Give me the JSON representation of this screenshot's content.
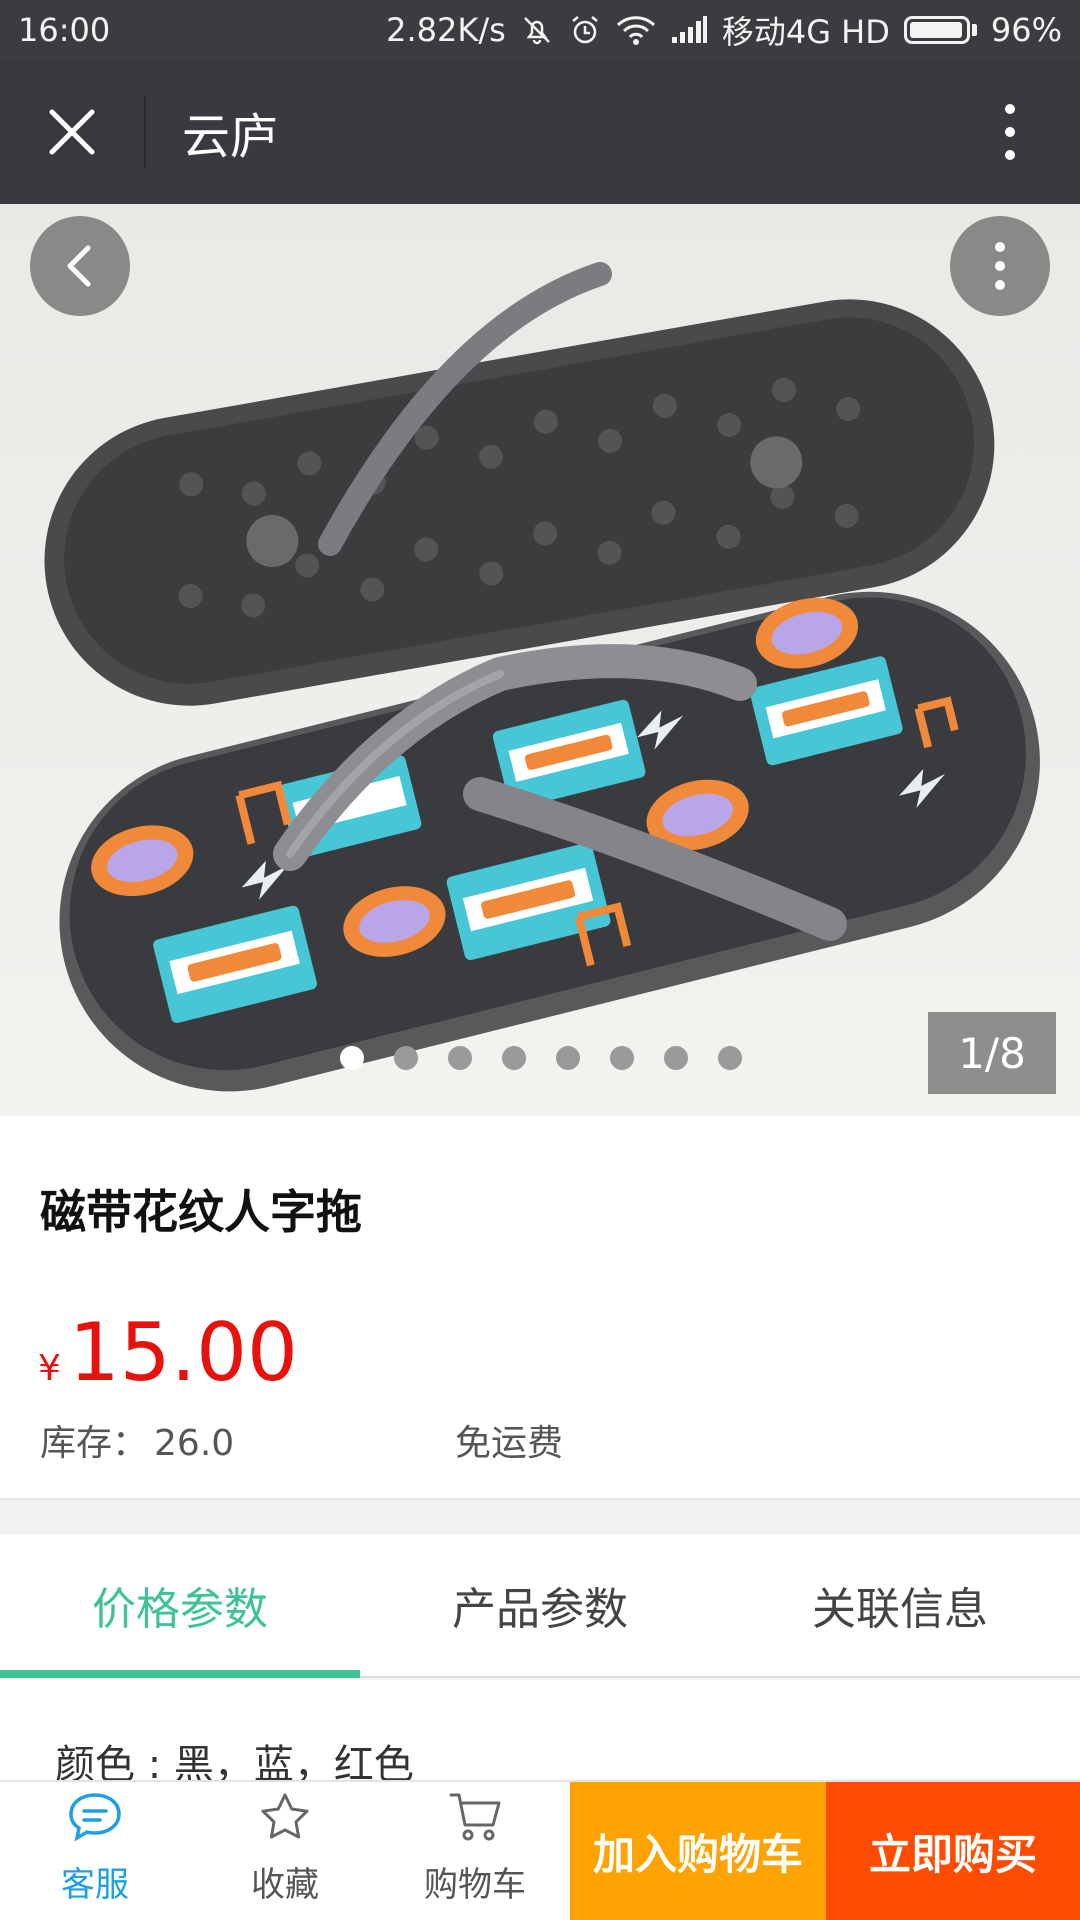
{
  "status_bar": {
    "time": "16:00",
    "speed": "2.82K/s",
    "carrier": "移动4G HD",
    "battery": "96%",
    "battery_level": 0.96
  },
  "header": {
    "title": "云庐"
  },
  "gallery": {
    "counter": "1/8",
    "total": 8,
    "current": 1,
    "image_semantic": "product-photo-flip-flops"
  },
  "product": {
    "name": "磁带花纹人字拖",
    "currency": "¥",
    "price": "15.00",
    "stock_label": "库存：",
    "stock_value": "26.0",
    "shipping": "免运费"
  },
  "tabs": [
    {
      "label": "价格参数",
      "active": true
    },
    {
      "label": "产品参数",
      "active": false
    },
    {
      "label": "关联信息",
      "active": false
    }
  ],
  "content": {
    "color_line": "颜色 : 黑，蓝，红色"
  },
  "bottom_bar": {
    "service": "客服",
    "favorite": "收藏",
    "cart": "购物车",
    "add_to_cart": "加入购物车",
    "buy_now": "立即购买"
  },
  "colors": {
    "accent_green": "#3fc394",
    "price_red": "#e8120c",
    "cart_orange": "#fea301",
    "buy_orange": "#ff4c00",
    "service_blue": "#1e9fe2",
    "header_bg": "#393a3f"
  }
}
